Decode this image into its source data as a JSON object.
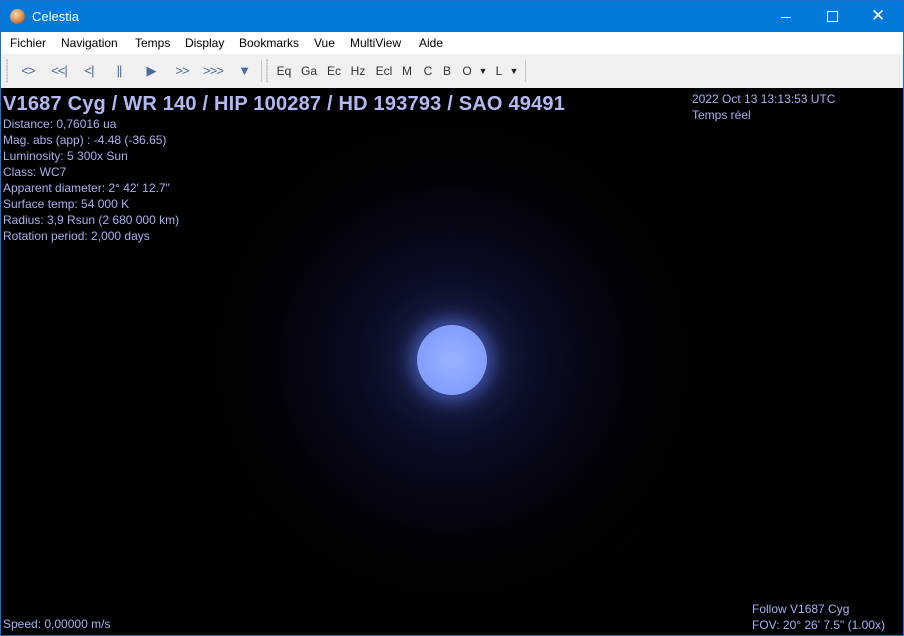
{
  "window": {
    "title": "Celestia",
    "controls": {
      "minimize": "minimize",
      "maximize": "maximize",
      "close": "close"
    }
  },
  "menu": {
    "items": [
      "Fichier",
      "Navigation",
      "Temps",
      "Display",
      "Bookmarks",
      "Vue",
      "MultiView",
      "Aide"
    ]
  },
  "toolbar": {
    "time_buttons": [
      {
        "name": "reverse-time",
        "glyph": "<>"
      },
      {
        "name": "much-slower",
        "glyph": "<<|"
      },
      {
        "name": "slower",
        "glyph": "<|"
      },
      {
        "name": "pause",
        "glyph": "||"
      },
      {
        "name": "play",
        "glyph": "▶"
      },
      {
        "name": "faster",
        "glyph": ">>"
      },
      {
        "name": "much-faster",
        "glyph": ">>>"
      },
      {
        "name": "filter",
        "glyph": "▼"
      }
    ],
    "render_buttons": [
      "Eq",
      "Ga",
      "Ec",
      "Hz",
      "Ecl",
      "M",
      "C",
      "B",
      "O",
      "L"
    ]
  },
  "overlay": {
    "title": "V1687 Cyg / WR 140 / HIP 100287 / HD 193793 / SAO 49491",
    "lines": [
      "Distance: 0,76016 ua",
      "Mag. abs (app) : -4.48 (-36.65)",
      "Luminosity: 5 300x Sun",
      "Class: WC7",
      "Apparent diameter: 2° 42' 12.7\"",
      "Surface temp: 54 000 K",
      "Radius: 3,9 Rsun  (2 680 000 km)",
      "Rotation period: 2,000 days"
    ],
    "datetime": "2022 Oct 13 13:13:53 UTC",
    "time_mode": "Temps réel",
    "speed": "Speed: 0,00000 m/s",
    "follow": "Follow V1687 Cyg",
    "fov": "FOV: 20° 26' 7.5\" (1.00x)"
  },
  "colors": {
    "titlebar": "#0078d7",
    "overlay_text": "#a9b0ee",
    "star": "#8aa5ff",
    "space": "#000000"
  }
}
